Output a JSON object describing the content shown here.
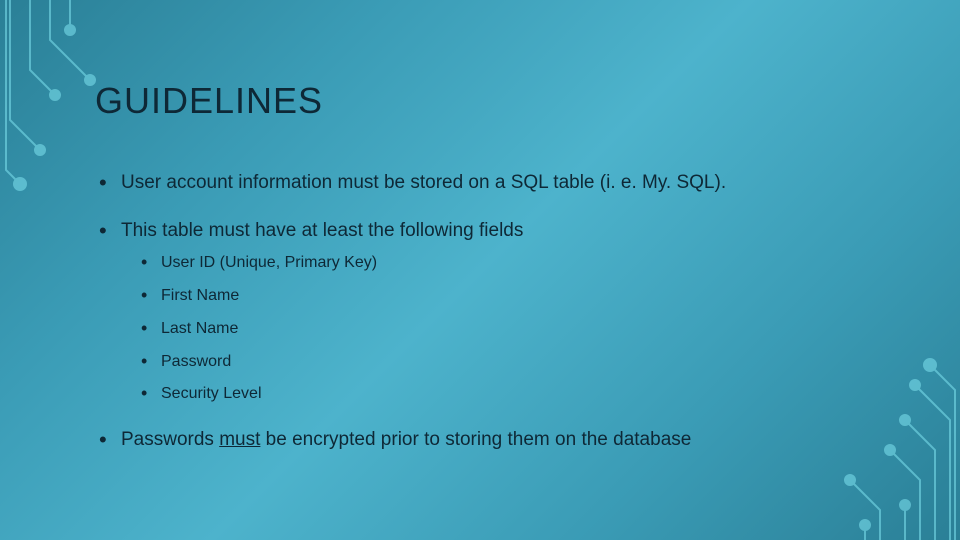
{
  "title": "GUIDELINES",
  "bullets": {
    "b1": "User account information must be stored on a SQL table (i. e. My. SQL).",
    "b2": "This table must have at least the following fields",
    "b2_sub": {
      "s1": "User ID (Unique, Primary Key)",
      "s2": "First Name",
      "s3": "Last Name",
      "s4": "Password",
      "s5": "Security Level"
    },
    "b3_pre": "Passwords ",
    "b3_underline": "must",
    "b3_post": " be encrypted prior to storing them on the database"
  }
}
